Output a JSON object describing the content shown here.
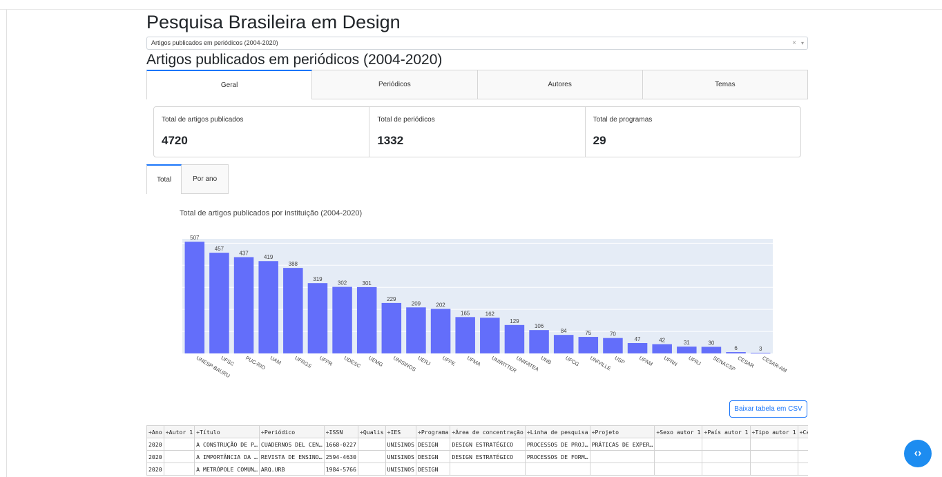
{
  "app": {
    "title": "Pesquisa Brasileira em Design",
    "dropdown_value": "Artigos publicados em periódicos (2004-2020)",
    "dropdown_clear": "×",
    "dropdown_caret": "▾",
    "section_title": "Artigos publicados em periódicos (2004-2020)"
  },
  "tabs": [
    {
      "label": "Geral",
      "active": true
    },
    {
      "label": "Periódicos",
      "active": false
    },
    {
      "label": "Autores",
      "active": false
    },
    {
      "label": "Temas",
      "active": false
    }
  ],
  "cards": [
    {
      "label": "Total de artigos publicados",
      "value": "4720"
    },
    {
      "label": "Total de periódicos",
      "value": "1332"
    },
    {
      "label": "Total de programas",
      "value": "29"
    }
  ],
  "subtabs": [
    {
      "label": "Total",
      "active": true
    },
    {
      "label": "Por ano",
      "active": false
    }
  ],
  "chart_data": {
    "type": "bar",
    "title": "Total de artigos publicados por instituição (2004-2020)",
    "categories": [
      "UNESP-BAURU",
      "UFSC",
      "PUC-RIO",
      "UAM",
      "UFRGS",
      "UFPR",
      "UDESC",
      "UEMG",
      "UNISINOS",
      "UERJ",
      "UFPE",
      "UFMA",
      "UNIRITTER",
      "UNIFATEA",
      "UNB",
      "UFCG",
      "UNIVILLE",
      "USP",
      "UFAM",
      "UFRN",
      "UFRJ",
      "SENACSP",
      "CESAR",
      "CESAR-AM"
    ],
    "values": [
      507,
      457,
      437,
      419,
      388,
      319,
      302,
      301,
      229,
      209,
      202,
      165,
      162,
      129,
      106,
      84,
      75,
      70,
      47,
      42,
      31,
      30,
      6,
      3
    ],
    "ylim": [
      0,
      520
    ],
    "bar_color": "#636EFA",
    "plot_bg": "#E5ECF6",
    "grid": true
  },
  "csv_button": "Baixar tabela em CSV",
  "table": {
    "columns": [
      "÷Ano",
      "÷Autor 1",
      "÷Título",
      "÷Periódico",
      "÷ISSN",
      "÷Qualis",
      "÷IES",
      "÷Programa",
      "÷Área de concentração",
      "÷Linha de pesquisa",
      "÷Projeto",
      "÷Sexo autor 1",
      "÷País autor 1",
      "÷Tipo autor 1",
      "÷Cat"
    ],
    "rows": [
      [
        "2020",
        "",
        "A CONSTRUÇÃO DE P…",
        "CUADERNOS DEL CEN…",
        "1668-0227",
        "",
        "UNISINOS",
        "DESIGN",
        "DESIGN ESTRATÉGICO",
        "PROCESSOS DE PROJ…",
        "PRÁTICAS DE EXPER…",
        "",
        "",
        "",
        ""
      ],
      [
        "2020",
        "",
        "A IMPORTÂNCIA DA …",
        "REVISTA DE ENSINO…",
        "2594-4630",
        "",
        "UNISINOS",
        "DESIGN",
        "DESIGN ESTRATÉGICO",
        "PROCESSOS DE FORM…",
        "",
        "",
        "",
        "",
        ""
      ],
      [
        "2020",
        "",
        "A METRÓPOLE COMUN…",
        "ARQ.URB",
        "1984-5766",
        "",
        "UNISINOS",
        "DESIGN",
        "",
        "",
        "",
        "",
        "",
        "",
        ""
      ]
    ]
  },
  "fab_icon": "code-icon",
  "fab_label": "‹›"
}
